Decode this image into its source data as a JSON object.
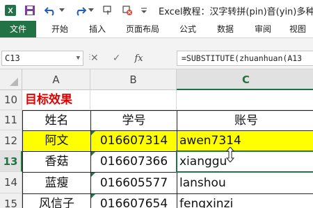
{
  "window": {
    "title": "Excel教程：汉字转拼(pin)音(yin)多种解"
  },
  "quick_access": {
    "icons": [
      "excel-logo-icon",
      "save-icon",
      "undo-icon",
      "redo-icon",
      "touch-mode-icon",
      "clear-format-icon",
      "customize-qat-icon"
    ]
  },
  "ribbon": {
    "tabs": [
      {
        "label": "文件",
        "active": true
      },
      {
        "label": "开始"
      },
      {
        "label": "插入"
      },
      {
        "label": "页面布局"
      },
      {
        "label": "公式"
      },
      {
        "label": "数据"
      },
      {
        "label": "审阅"
      },
      {
        "label": "视图"
      }
    ]
  },
  "formula_bar": {
    "name_box": "C13",
    "cancel_symbol": "✕",
    "enter_symbol": "✓",
    "fx_symbol": "fx",
    "formula": "=SUBSTITUTE(zhuanhuan(A13"
  },
  "sheet": {
    "columns": [
      "A",
      "B",
      "C"
    ],
    "selected_column": "C",
    "selected_row": "13",
    "rows": [
      {
        "num": "10",
        "a": "目标效果",
        "b": "",
        "c": ""
      },
      {
        "num": "11",
        "a": "姓名",
        "b": "学号",
        "c": "账号"
      },
      {
        "num": "12",
        "a": "阿文",
        "b": "016607314",
        "c": "awen7314"
      },
      {
        "num": "13",
        "a": "香菇",
        "b": "016607366",
        "c": "xianggu"
      },
      {
        "num": "14",
        "a": "蓝瘦",
        "b": "016605577",
        "c": "lanshou"
      },
      {
        "num": "15",
        "a": "风信子",
        "b": "016607654",
        "c": "fengxinzi"
      }
    ],
    "colors": {
      "highlight": "#ffff00",
      "title_text": "#e00000",
      "excel_green": "#217346"
    }
  }
}
